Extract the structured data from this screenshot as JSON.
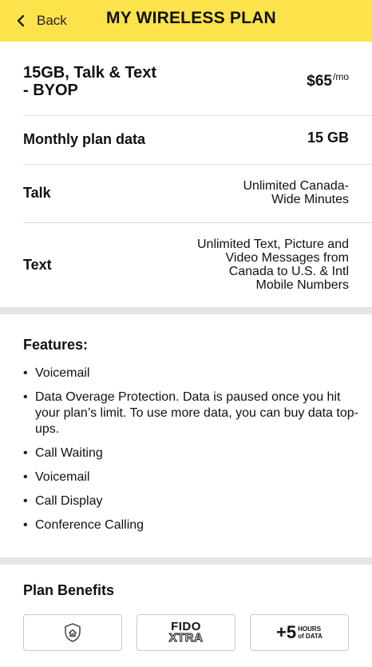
{
  "header": {
    "back_label": "Back",
    "title": "MY WIRELESS PLAN",
    "background": "#fde34b"
  },
  "plan": {
    "name": "15GB, Talk & Text\n- BYOP",
    "price": "$65",
    "per": "/mo"
  },
  "details": [
    {
      "label": "Monthly plan data",
      "value": "15 GB"
    },
    {
      "label": "Talk",
      "value": "Unlimited Canada-\nWide Minutes"
    },
    {
      "label": "Text",
      "value": "Unlimited Text, Picture and\nVideo Messages from\nCanada to U.S. & Intl\nMobile Numbers"
    }
  ],
  "features": {
    "title": "Features:",
    "items": [
      "Voicemail",
      "Data Overage Protection. Data is paused once you hit your plan’s limit. To use more data, you can buy data top-ups.",
      "Call Waiting",
      "Voicemail",
      "Call Display",
      "Conference Calling"
    ]
  },
  "benefits": {
    "title": "Plan Benefits",
    "tiles": [
      {
        "icon": "home-shield-icon"
      },
      {
        "line1": "FIDO",
        "line2": "XTRA"
      },
      {
        "big": "+5",
        "small1": "HOURS",
        "small2": "of DATA"
      }
    ]
  }
}
